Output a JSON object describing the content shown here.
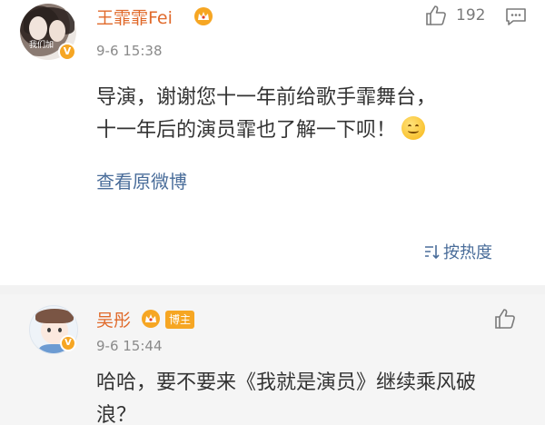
{
  "comment": {
    "username": "王霏霏Fei",
    "avatar_caption": "我们加",
    "time": "9-6 15:38",
    "like_count": "192",
    "text_line1": "导演，谢谢您十一年前给歌手霏舞台，",
    "text_line2": "十一年后的演员霏也了解一下呗！",
    "view_original": "查看原微博",
    "sort_label": "按热度"
  },
  "reply": {
    "username": "吴彤",
    "badge": "博主",
    "time": "9-6 15:44",
    "text_line1": "哈哈，要不要来《我就是演员》继续乘风破",
    "text_line2": "浪？"
  },
  "verified_mark": "V",
  "colors": {
    "username": "#e06a2b",
    "link": "#4a6d9a",
    "meta": "#8a8a8a",
    "verified": "#f6a623",
    "reply_bg": "#f5f5f5"
  },
  "icons": [
    "thumbs-up-icon",
    "message-icon",
    "crown-icon",
    "verified-icon",
    "smile-emoji-icon",
    "sort-icon"
  ]
}
